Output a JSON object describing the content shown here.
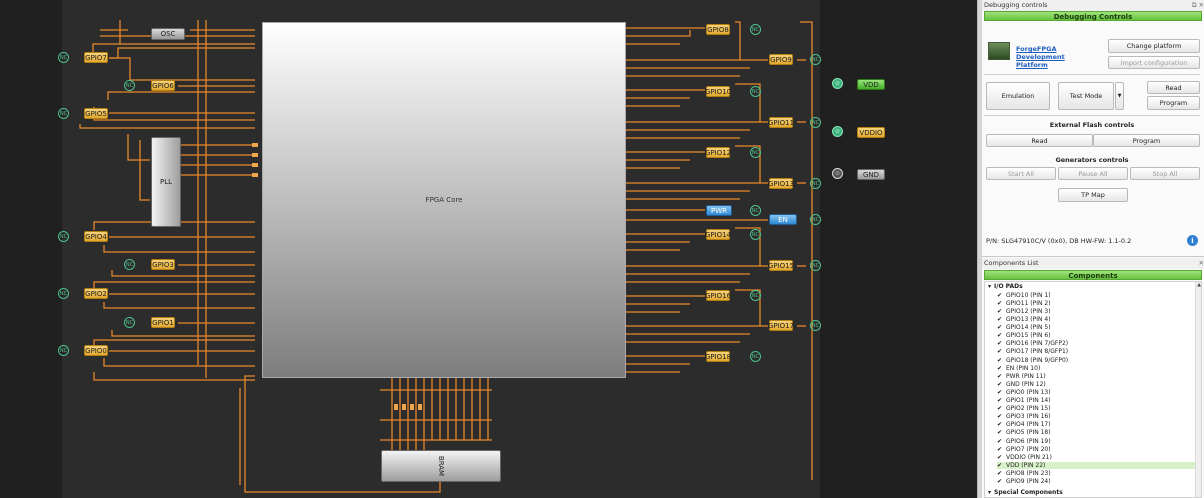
{
  "canvas": {
    "core_label": "FPGA Core",
    "pll_label": "PLL",
    "osc_label": "OSC",
    "bram_label": "BRAM",
    "nc_label": "NC",
    "left_gpios": [
      "GPIO7",
      "GPIO6",
      "GPIO5",
      "GPIO4",
      "GPIO3",
      "GPIO2",
      "GPIO1",
      "GPIO0"
    ],
    "right_gpios": [
      "GPIO8",
      "GPIO9",
      "GPIO10",
      "GPIO11",
      "GPIO12",
      "GPIO13",
      "PWR",
      "EN",
      "GPIO14",
      "GPIO15",
      "GPIO16",
      "GPIO17",
      "GPIO18"
    ],
    "pins": {
      "vdd": "VDD",
      "vddio": "VDDIO",
      "gnd": "GND"
    }
  },
  "debug": {
    "window_title": "Debugging controls",
    "header": "Debugging Controls",
    "platform_link": "ForgeFPGA Development Platform",
    "change_platform": "Change platform",
    "import_config": "Import configuration",
    "emulation": "Emulation",
    "test_mode": "Test Mode",
    "read": "Read",
    "program": "Program",
    "ext_flash_header": "External Flash controls",
    "flash_read": "Read",
    "flash_program": "Program",
    "gen_header": "Generators controls",
    "start_all": "Start All",
    "pause_all": "Pause All",
    "stop_all": "Stop All",
    "tp_map": "TP Map",
    "part_info": "P/N: SLG47910C/V (0x0), DB HW-FW: 1.1-0.2"
  },
  "components": {
    "window_title": "Components List",
    "header": "Components",
    "group": "I/O PADs",
    "items": [
      "GPIO10 (PIN 1)",
      "GPIO11 (PIN 2)",
      "GPIO12 (PIN 3)",
      "GPIO13 (PIN 4)",
      "GPIO14 (PIN 5)",
      "GPIO15 (PIN 6)",
      "GPIO16 (PIN 7/GFP2)",
      "GPIO17 (PIN 8/GFP1)",
      "GPIO18 (PIN 9/GFP0)",
      "EN (PIN 10)",
      "PWR (PIN 11)",
      "GND (PIN 12)",
      "GPIO0 (PIN 13)",
      "GPIO1 (PIN 14)",
      "GPIO2 (PIN 15)",
      "GPIO3 (PIN 16)",
      "GPIO4 (PIN 17)",
      "GPIO5 (PIN 18)",
      "GPIO6 (PIN 19)",
      "GPIO7 (PIN 20)",
      "VDDIO (PIN 21)",
      "VDD (PIN 22)",
      "GPIO8 (PIN 23)",
      "GPIO9 (PIN 24)"
    ],
    "selected_item": "VDD (PIN 22)",
    "special_group": "Special Components"
  },
  "colors": {
    "wire": "#e8892a",
    "canvas": "#2c2c2c",
    "accent_green": "#66c33f",
    "nc_green": "#4fc28f"
  }
}
